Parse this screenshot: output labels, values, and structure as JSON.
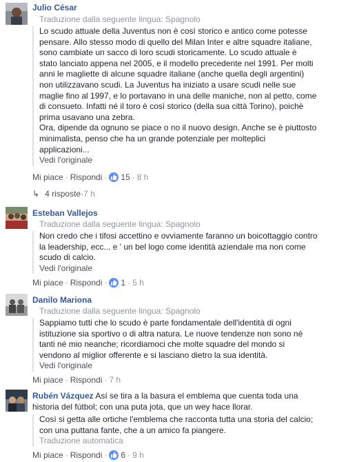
{
  "comments": [
    {
      "author": "Julio César",
      "translated_from": "Traduzione dalla seguente lingua: Spagnolo",
      "text_lines": [
        "Lo scudo attuale della Juventus non è così storico e antico come potesse",
        "pensare. Allo stesso modo di quello del Milan Inter e altre squadre italiane,",
        "sono cambiate un sacco di loro scudi storicamente. Lo scudo attuale è",
        "stato lanciato appena nel 2005, e il modello precedente nel 1991. Per molti",
        "anni le magliette di alcune squadre italiane (anche quella degli argentini)",
        "non utilizzavano scudi. La Juventus ha iniziato a usare scudi nelle sue",
        "maglie fino al 1997, e lo portavano in una delle maniche, non al petto, come",
        "di consueto. Infatti né il toro è così storico (della sua città Torino), poichè",
        "prima usavano una zebra.",
        "Ora, dipende da ognuno se piace o no il nuovo design. Anche se è piuttosto",
        "minimalista, penso che ha un grande potenziale per molteplici",
        "applicazioni..."
      ],
      "see_original": "Vedi l'originale",
      "like_label": "Mi piace",
      "reply_label": "Rispondi",
      "reaction_count": "15",
      "time": "8 h",
      "replies": "4 risposte",
      "replies_time": "7 h"
    },
    {
      "author": "Esteban Vallejos",
      "translated_from": "Traduzione dalla seguente lingua: Spagnolo",
      "text_lines": [
        "Non credo che i tifosi accettino e ovviamente faranno un boicottaggio contro",
        "la leadership, ecc... e ' un bel logo come identità aziendale ma non come",
        "scudo di calcio."
      ],
      "see_original": "Vedi l'originale",
      "like_label": "Mi piace",
      "reply_label": "Rispondi",
      "reaction_count": "1",
      "time": "5 h"
    },
    {
      "author": "Danilo Mariona",
      "translated_from": "Traduzione dalla seguente lingua: Spagnolo",
      "text_lines": [
        "Sappiamo tutti che lo scudo è parte fondamentale dell'identità di ogni",
        "istituzione sia sportivo o di altra natura. Le nuove tendenze non sono né",
        "tanti né mio neanche; ricordiamoci che molte squadre del mondo si",
        "vendono al miglior offerente e si lasciano dietro la sua identità."
      ],
      "see_original": "Vedi l'originale",
      "like_label": "Mi piace",
      "reply_label": "Rispondi",
      "time": "7 h"
    },
    {
      "author": "Rubén Vázquez",
      "original_line1": "Así se tira a la basura el emblema que cuenta toda una",
      "original_line2": "historia del fútbol; con una puta jota, que un wey hace llorar.",
      "translation_lines": [
        "Così si getta alle ortiche l'emblema che racconta tutta una storia del calcio;",
        "con una puttana fante, che a un amico fa piangere."
      ],
      "auto_translation": "Traduzione automatica",
      "like_label": "Mi piace",
      "reply_label": "Rispondi",
      "reaction_count": "6",
      "time": "9 h"
    }
  ],
  "colors": {
    "link": "#365899",
    "meta": "#90949c",
    "like": "#5890ff",
    "border": "#dddfe2"
  }
}
